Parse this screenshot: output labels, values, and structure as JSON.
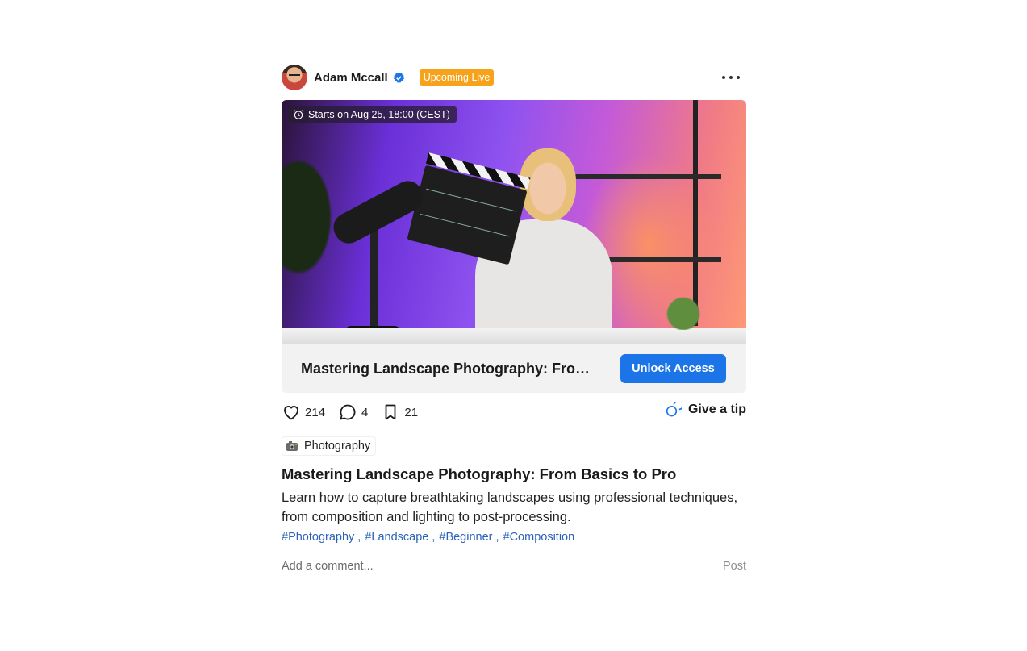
{
  "author": {
    "name": "Adam Mccall",
    "verified_icon": "verified-badge-icon",
    "badge": "Upcoming Live"
  },
  "media": {
    "schedule": "Starts on Aug 25, 18:00 (CEST)",
    "title": "Mastering Landscape Photography: From Basics to Pro",
    "unlock_label": "Unlock Access"
  },
  "actions": {
    "likes": "214",
    "comments": "4",
    "saves": "21",
    "tip_label": "Give a tip"
  },
  "post": {
    "category": "Photography",
    "title": "Mastering Landscape Photography: From Basics to Pro",
    "description": "Learn how to capture breathtaking landscapes using professional techniques, from composition and lighting to post-processing.",
    "tags": [
      "#Photography",
      "#Landscape",
      "#Beginner",
      "#Composition"
    ]
  },
  "comment": {
    "placeholder": "Add a comment...",
    "post_label": "Post"
  },
  "colors": {
    "accent": "#1b74e8",
    "badge": "#f7a21b",
    "tag": "#2a62b8"
  }
}
